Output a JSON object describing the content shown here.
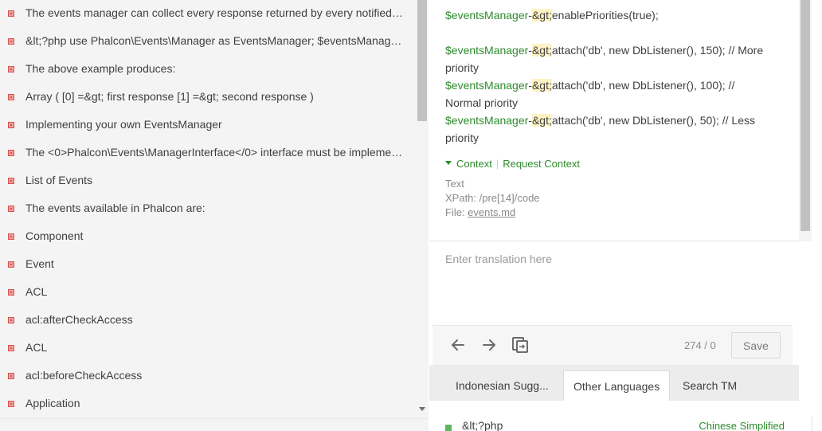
{
  "strings_list": {
    "items": [
      "The events manager can collect every response returned by every notified lis...",
      "&lt;?php use Phalcon\\Events\\Manager as EventsManager; $eventsManager = ...",
      "The above example produces:",
      "Array ( [0] =&gt; first response [1] =&gt; second response )",
      "Implementing your own EventsManager",
      "The <0>Phalcon\\Events\\ManagerInterface</0> interface must be implement...",
      "List of Events",
      "The events available in Phalcon are:",
      "Component",
      "Event",
      "ACL",
      "acl:afterCheckAccess",
      "ACL",
      "acl:beforeCheckAccess",
      "Application"
    ]
  },
  "source": {
    "line1": {
      "var": "$eventsManager",
      "dash": "-",
      "ent": "&gt;",
      "rest": "enablePriorities(true);"
    },
    "line2": {
      "var": "$eventsManager",
      "dash": "-",
      "ent": "&gt;",
      "rest": "attach('db', new DbListener(), 150); // More",
      "cont": "priority"
    },
    "line3": {
      "var": "$eventsManager",
      "dash": "-",
      "ent": "&gt;",
      "rest": "attach('db', new DbListener(), 100); //",
      "cont": "Normal priority"
    },
    "line4": {
      "var": "$eventsManager",
      "dash": "-",
      "ent": "&gt;",
      "rest": "attach('db', new DbListener(), 50);  // Less",
      "cont": "priority"
    }
  },
  "context": {
    "context_label": "Context",
    "separator": "|",
    "request_label": "Request Context",
    "type": "Text",
    "xpath": "XPath: /pre[14]/code",
    "file_prefix": "File: ",
    "file_name": "events.md"
  },
  "translation": {
    "placeholder": "Enter translation here"
  },
  "toolbar": {
    "counter": "274 / 0",
    "save_label": "Save"
  },
  "tabs": {
    "indonesian": "Indonesian Sugg...",
    "other_languages": "Other Languages",
    "search_tm": "Search TM",
    "active": "other_languages"
  },
  "suggestion": {
    "text": "&lt;?php",
    "language": "Chinese Simplified"
  },
  "colors": {
    "accent_green": "#2e8b2e",
    "status_red": "#d9534f",
    "entity_highlight": "#fff3c4"
  }
}
